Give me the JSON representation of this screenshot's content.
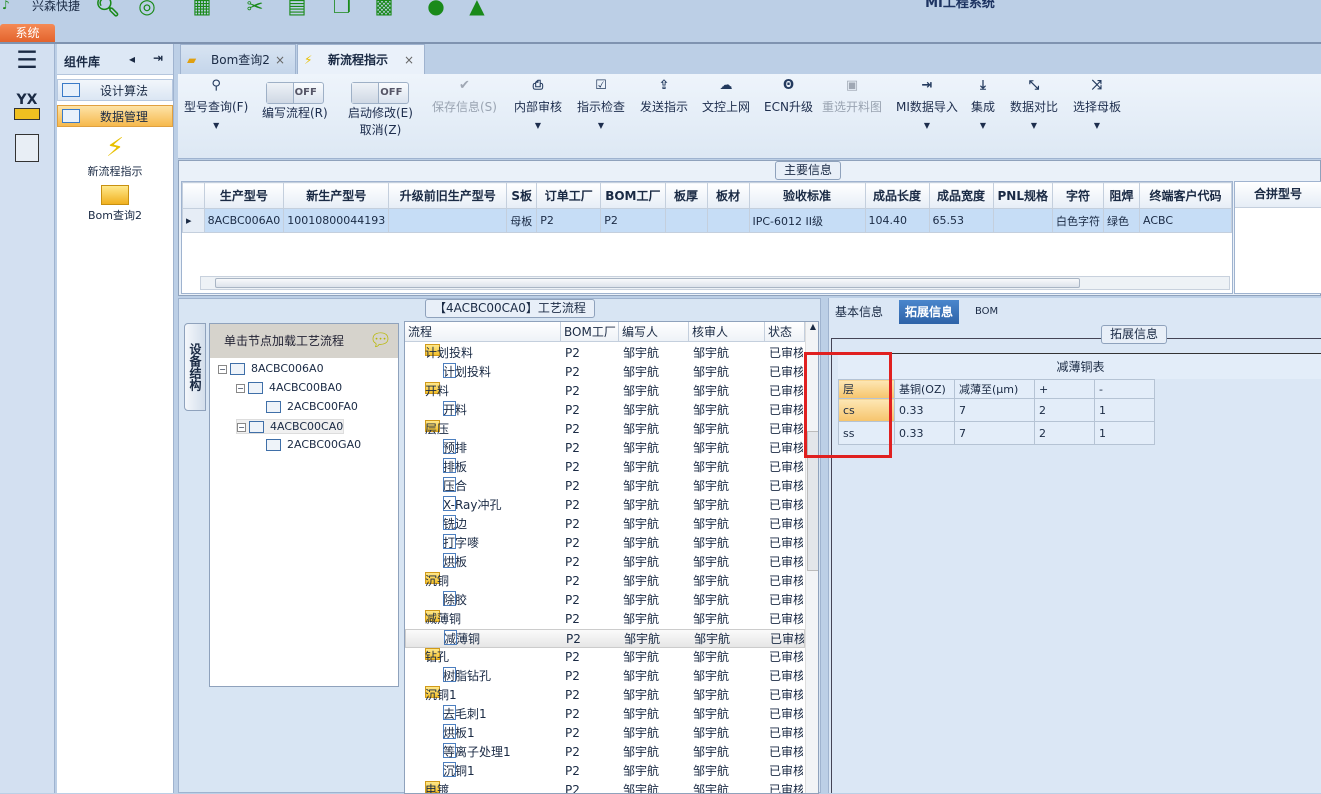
{
  "app": {
    "title": "MI工程系统",
    "quick_label": "兴森快捷",
    "ribbon_tab": "系统"
  },
  "quick_icons": [
    "search-icon",
    "lifebuoy-icon",
    "table-icon",
    "scissors-icon",
    "film-icon",
    "copy-icon",
    "grid-icon",
    "user-icon",
    "image-icon"
  ],
  "component_panel": {
    "title": "组件库",
    "items": [
      {
        "label": "设计算法"
      },
      {
        "label": "数据管理"
      }
    ],
    "tiles": [
      {
        "label": "新流程指示"
      },
      {
        "label": "Bom查询2"
      }
    ]
  },
  "doc_tabs": [
    {
      "label": "Bom查询2"
    },
    {
      "label": "新流程指示"
    }
  ],
  "toolbar": {
    "model_query": "型号查询(F)",
    "write_flow": "编写流程(R)",
    "write_flow_toggle": "OFF",
    "start_modify": "启动修改(E)",
    "start_modify_toggle": "OFF",
    "cancel": "取消(Z)",
    "save": "保存信息(S)",
    "internal_review": "内部审核",
    "check": "指示检查",
    "send": "发送指示",
    "upload": "文控上网",
    "ecn": "ECN升级",
    "reselect": "重选开料图",
    "mi_import": "MI数据导入",
    "integrate": "集成",
    "compare": "数据对比",
    "select_mother": "选择母板"
  },
  "main_info": {
    "title": "主要信息",
    "columns": [
      "生产型号",
      "新生产型号",
      "升级前旧生产型号",
      "S板",
      "订单工厂",
      "BOM工厂",
      "板厚",
      "板材",
      "验收标准",
      "成品长度",
      "成品宽度",
      "PNL规格",
      "字符",
      "阻焊",
      "终端客户代码"
    ],
    "row": [
      "8ACBC006A0",
      "10010800044193",
      "",
      "母板",
      "P2",
      "P2",
      "",
      "",
      "IPC-6012 II级",
      "104.40",
      "65.53",
      "",
      "白色字符",
      "绿色",
      "ACBC"
    ],
    "side_header": "合拼型号"
  },
  "process": {
    "title": "【4ACBC00CA0】工艺流程",
    "side_tab": "设备结构",
    "tree_header": "单击节点加载工艺流程",
    "tree": [
      {
        "label": "8ACBC006A0",
        "level": 0
      },
      {
        "label": "4ACBC00BA0",
        "level": 1
      },
      {
        "label": "2ACBC00FA0",
        "level": 2
      },
      {
        "label": "4ACBC00CA0",
        "level": 1
      },
      {
        "label": "2ACBC00GA0",
        "level": 2
      }
    ],
    "columns": [
      "流程",
      "BOM工厂",
      "编写人",
      "核审人",
      "状态"
    ],
    "rows": [
      {
        "name": "计划投料",
        "folder": true
      },
      {
        "name": "计划投料"
      },
      {
        "name": "开料",
        "folder": true
      },
      {
        "name": "开料"
      },
      {
        "name": "层压",
        "folder": true
      },
      {
        "name": "预排"
      },
      {
        "name": "排板"
      },
      {
        "name": "压合"
      },
      {
        "name": "X-Ray冲孔"
      },
      {
        "name": "铣边"
      },
      {
        "name": "打字嘜"
      },
      {
        "name": "烘板"
      },
      {
        "name": "沉铜",
        "folder": true
      },
      {
        "name": "除胶"
      },
      {
        "name": "减薄铜",
        "folder": true
      },
      {
        "name": "减薄铜",
        "selected": true
      },
      {
        "name": "钻孔",
        "folder": true
      },
      {
        "name": "树脂钻孔"
      },
      {
        "name": "沉铜1",
        "folder": true
      },
      {
        "name": "去毛刺1"
      },
      {
        "name": "烘板1"
      },
      {
        "name": "等离子处理1"
      },
      {
        "name": "沉铜1"
      },
      {
        "name": "电镀",
        "folder": true
      }
    ],
    "factory": "P2",
    "writer": "邹宇航",
    "reviewer": "邹宇航",
    "status": "已审核"
  },
  "ext": {
    "tabs": [
      "基本信息",
      "拓展信息",
      "BOM"
    ],
    "group_title": "拓展信息",
    "table_title": "减薄铜表",
    "columns": [
      "层",
      "基铜(OZ)",
      "减薄至(μm)",
      "+",
      "-"
    ],
    "rows": [
      [
        "cs",
        "0.33",
        "7",
        "2",
        "1"
      ],
      [
        "ss",
        "0.33",
        "7",
        "2",
        "1"
      ]
    ]
  }
}
